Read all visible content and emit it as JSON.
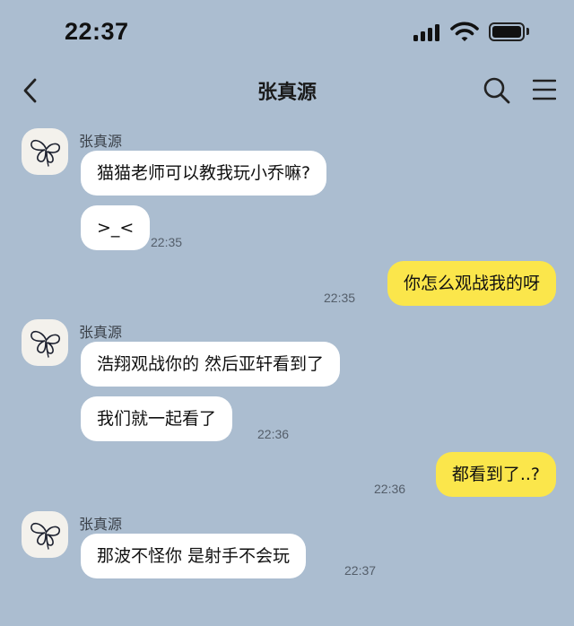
{
  "status_bar": {
    "time": "22:37"
  },
  "header": {
    "title": "张真源"
  },
  "messages": [
    {
      "sender": "张真源",
      "text": "猫猫老师可以教我玩小乔嘛?"
    },
    {
      "text": ">_<",
      "time": "22:35"
    },
    {
      "text": "你怎么观战我的呀",
      "time": "22:35"
    },
    {
      "sender": "张真源",
      "text": "浩翔观战你的 然后亚轩看到了"
    },
    {
      "text": "我们就一起看了",
      "time": "22:36"
    },
    {
      "text": "都看到了..?",
      "time": "22:36"
    },
    {
      "sender": "张真源",
      "text": "那波不怪你 是射手不会玩",
      "time": "22:37"
    }
  ],
  "colors": {
    "background": "#abbdd0",
    "incoming_bubble": "#ffffff",
    "outgoing_bubble": "#fbe64b"
  },
  "icons": [
    "signal-icon",
    "wifi-icon",
    "battery-icon",
    "back-icon",
    "search-icon",
    "menu-icon",
    "avatar-butterfly-icon"
  ]
}
